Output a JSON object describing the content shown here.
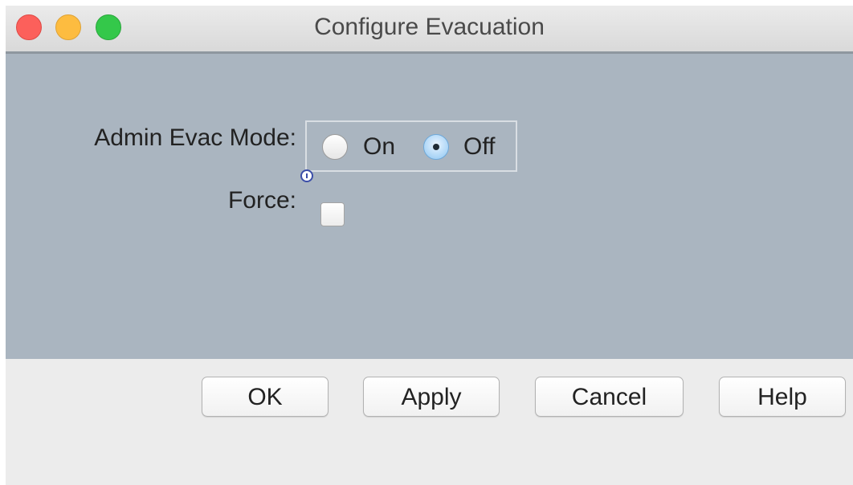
{
  "window": {
    "title": "Configure Evacuation"
  },
  "form": {
    "admin_evac_mode_label": "Admin Evac Mode:",
    "options": [
      {
        "label": "On",
        "selected": false
      },
      {
        "label": "Off",
        "selected": true
      }
    ],
    "force_label": "Force:",
    "force_checked": false
  },
  "buttons": {
    "ok": "OK",
    "apply": "Apply",
    "cancel": "Cancel",
    "help": "Help"
  },
  "colors": {
    "content_background": "#aab5c0",
    "close": "#fc605b",
    "minimize": "#fdbc40",
    "zoom": "#34c84a",
    "selected_radio": "#8ec6f2"
  }
}
